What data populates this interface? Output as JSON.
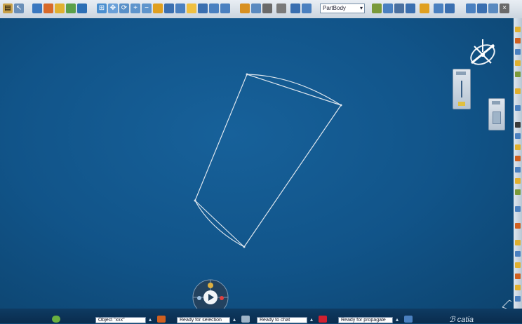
{
  "toolbar": {
    "partbody_value": "PartBody",
    "icons": [
      "file-icon",
      "select-icon",
      "snap-icon",
      "sketch-icon",
      "fit-all-icon",
      "pan-icon",
      "rotate-icon",
      "zoom-in-icon",
      "zoom-out-icon",
      "normal-view-icon",
      "quick-view-icon",
      "render-style-icon",
      "hide-show-icon",
      "swap-icon",
      "measure-icon",
      "analysis-icon",
      "macro-icon",
      "knowledge-icon",
      "tree-icon",
      "catalog-icon",
      "sketch-analysis-icon",
      "constraint-icon",
      "geometry-icon",
      "workbench-icon",
      "home-icon"
    ]
  },
  "statusbar": {
    "field1": "Object \"xxx\"",
    "field2": "Ready for selection",
    "field3": "Ready to chat",
    "field4": "Ready for propagate",
    "brand": "catia"
  },
  "colors": {
    "background": "#115489",
    "geometry": "#dde6ee",
    "toolbar": "#d9e1ea",
    "statusbar": "#0b3357"
  },
  "compass": {
    "label": "compass"
  },
  "robot_wheel": {
    "center_icon": "play-icon"
  }
}
